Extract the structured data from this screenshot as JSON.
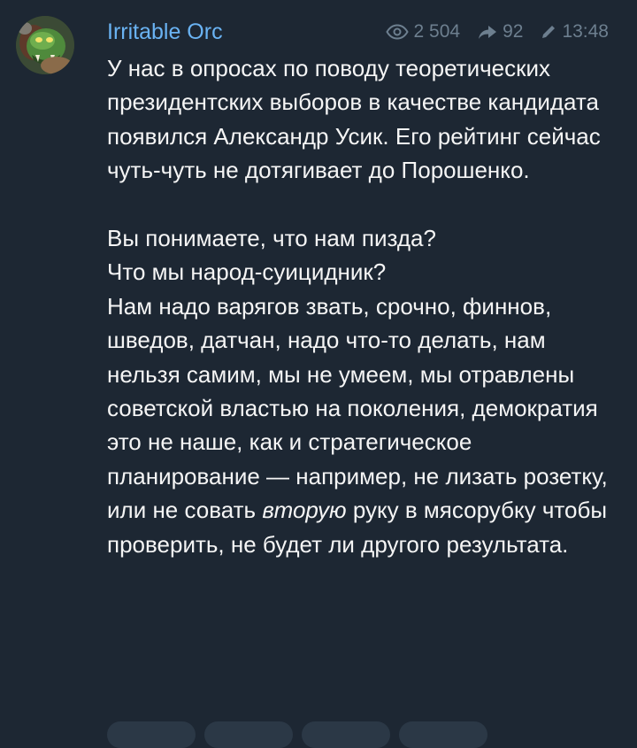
{
  "author": {
    "name": "Irritable Orc"
  },
  "meta": {
    "views": "2 504",
    "shares": "92",
    "time": "13:48",
    "icons": [
      "eye-icon",
      "share-arrow-icon",
      "pencil-edited-icon"
    ]
  },
  "post": {
    "paragraph1": "У нас в опросах по поводу теоретических президентских выборов в качестве кандидата появился Александр Усик. Его рейтинг сейчас чуть-чуть не дотягивает до Порошенко.",
    "line_question1": "Вы понимаете, что нам пизда?",
    "line_question2": "Что мы народ-суицидник?",
    "paragraph3_before_italic": "Нам надо варягов звать, срочно, финнов, шведов, датчан, надо что-то делать, нам нельзя самим, мы не умеем, мы отравлены советской властью на поколения, демократия это не наше, как и стратегическое планирование — например, не лизать розетку, или не совать ",
    "paragraph3_italic": "вторую",
    "paragraph3_after_italic": " руку в мясорубку чтобы проверить, не будет ли другого результата."
  },
  "colors": {
    "background": "#1d2733",
    "author": "#6ab3f3",
    "meta": "#6d7f8f",
    "text": "#f5f5f5"
  }
}
